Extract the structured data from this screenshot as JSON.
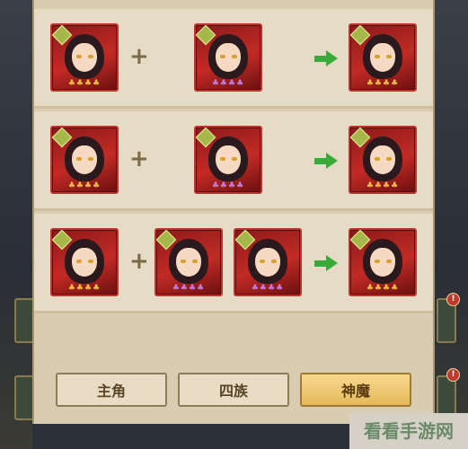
{
  "recipes": [
    {
      "row": 0,
      "inputs": [
        "gold",
        "purple"
      ],
      "output": "gold"
    },
    {
      "row": 1,
      "inputs": [
        "gold",
        "purple"
      ],
      "output": "gold"
    },
    {
      "row": 2,
      "inputs": [
        "gold",
        "purple",
        "purple"
      ],
      "output": "gold"
    }
  ],
  "tabs": {
    "protagonist": "主角",
    "four_clans": "四族",
    "gods_demons": "神魔",
    "active": "gods_demons"
  },
  "symbols": {
    "plus": "+"
  },
  "stars": {
    "gold": "♣♣♣♣",
    "purple": "♣♣♣♣"
  },
  "side_badge": "!",
  "watermark": "看看手游网",
  "colors": {
    "card_border": "#c0322c",
    "arrow": "#3aaa3a",
    "active_tab": "#e5b95a"
  }
}
